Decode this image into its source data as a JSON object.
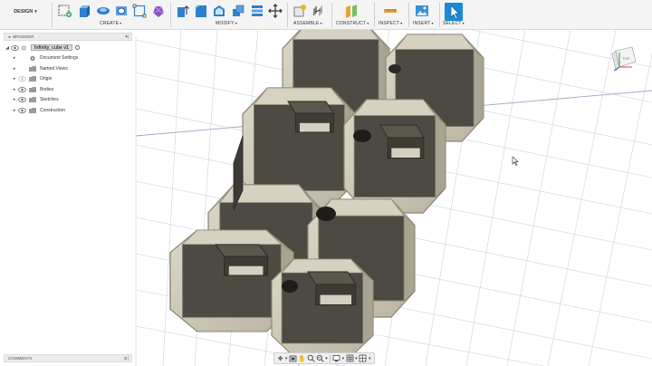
{
  "workspace": {
    "label": "DESIGN"
  },
  "toolbar_groups": [
    {
      "label": "CREATE"
    },
    {
      "label": "MODIFY"
    },
    {
      "label": "ASSEMBLE"
    },
    {
      "label": "CONSTRUCT"
    },
    {
      "label": "INSPECT"
    },
    {
      "label": "INSERT"
    },
    {
      "label": "SELECT"
    }
  ],
  "browser": {
    "title": "BROWSER",
    "items": [
      {
        "label": "Infinity_cube v1",
        "type": "document"
      },
      {
        "label": "Document Settings",
        "type": "settings"
      },
      {
        "label": "Named Views",
        "type": "folder"
      },
      {
        "label": "Origin",
        "type": "folder"
      },
      {
        "label": "Bodies",
        "type": "folder"
      },
      {
        "label": "Sketches",
        "type": "folder"
      },
      {
        "label": "Construction",
        "type": "folder"
      }
    ]
  },
  "comments": {
    "title": "COMMENTS"
  },
  "colors": {
    "accent": "#1b8ad6",
    "model_face": "#4c4a42",
    "model_edge": "#8c8672",
    "model_bevel": "#c9c4b3",
    "grid": "#c8d4e2"
  },
  "icons": [
    "create-sketch-icon",
    "extrude-icon",
    "revolve-icon",
    "hole-icon",
    "rectangle-icon",
    "form-icon",
    "press-pull-icon",
    "fillet-icon",
    "shell-icon",
    "combine-icon",
    "move-icon",
    "joint-icon",
    "offset-plane-icon",
    "measure-icon",
    "insert-image-icon",
    "select-icon"
  ]
}
